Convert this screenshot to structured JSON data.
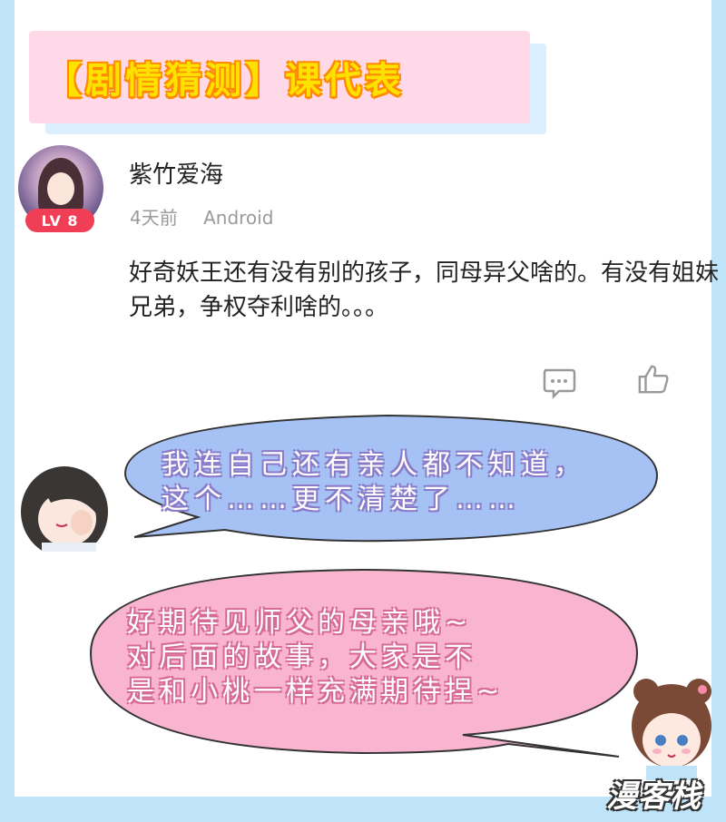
{
  "header": {
    "title": "【剧情猜测】课代表"
  },
  "post": {
    "username": "紫竹爱海",
    "level_badge": "LV 8",
    "time": "4天前",
    "platform": "Android",
    "comment": "好奇妖王还有没有别的孩子，同母异父啥的。有没有姐妹兄弟，争权夺利啥的。。。",
    "actions": {
      "reply_icon": "comment-icon",
      "like_icon": "thumbs-up-icon"
    }
  },
  "replies": {
    "blue_bubble": {
      "line1": "我连自己还有亲人都不知道，",
      "line2": "这个……更不清楚了……",
      "color": "#a6c2f5"
    },
    "pink_bubble": {
      "line1": "好期待见师父的母亲哦~",
      "line2": "对后面的故事，大家是不",
      "line3": "是和小桃一样充满期待捏~",
      "color": "#f9b4d0"
    }
  },
  "watermark": "漫客栈",
  "colors": {
    "background": "#bfe3f8",
    "title_bg": "#ffd9e8",
    "title_text": "#ffe100",
    "badge": "#f03e57"
  }
}
